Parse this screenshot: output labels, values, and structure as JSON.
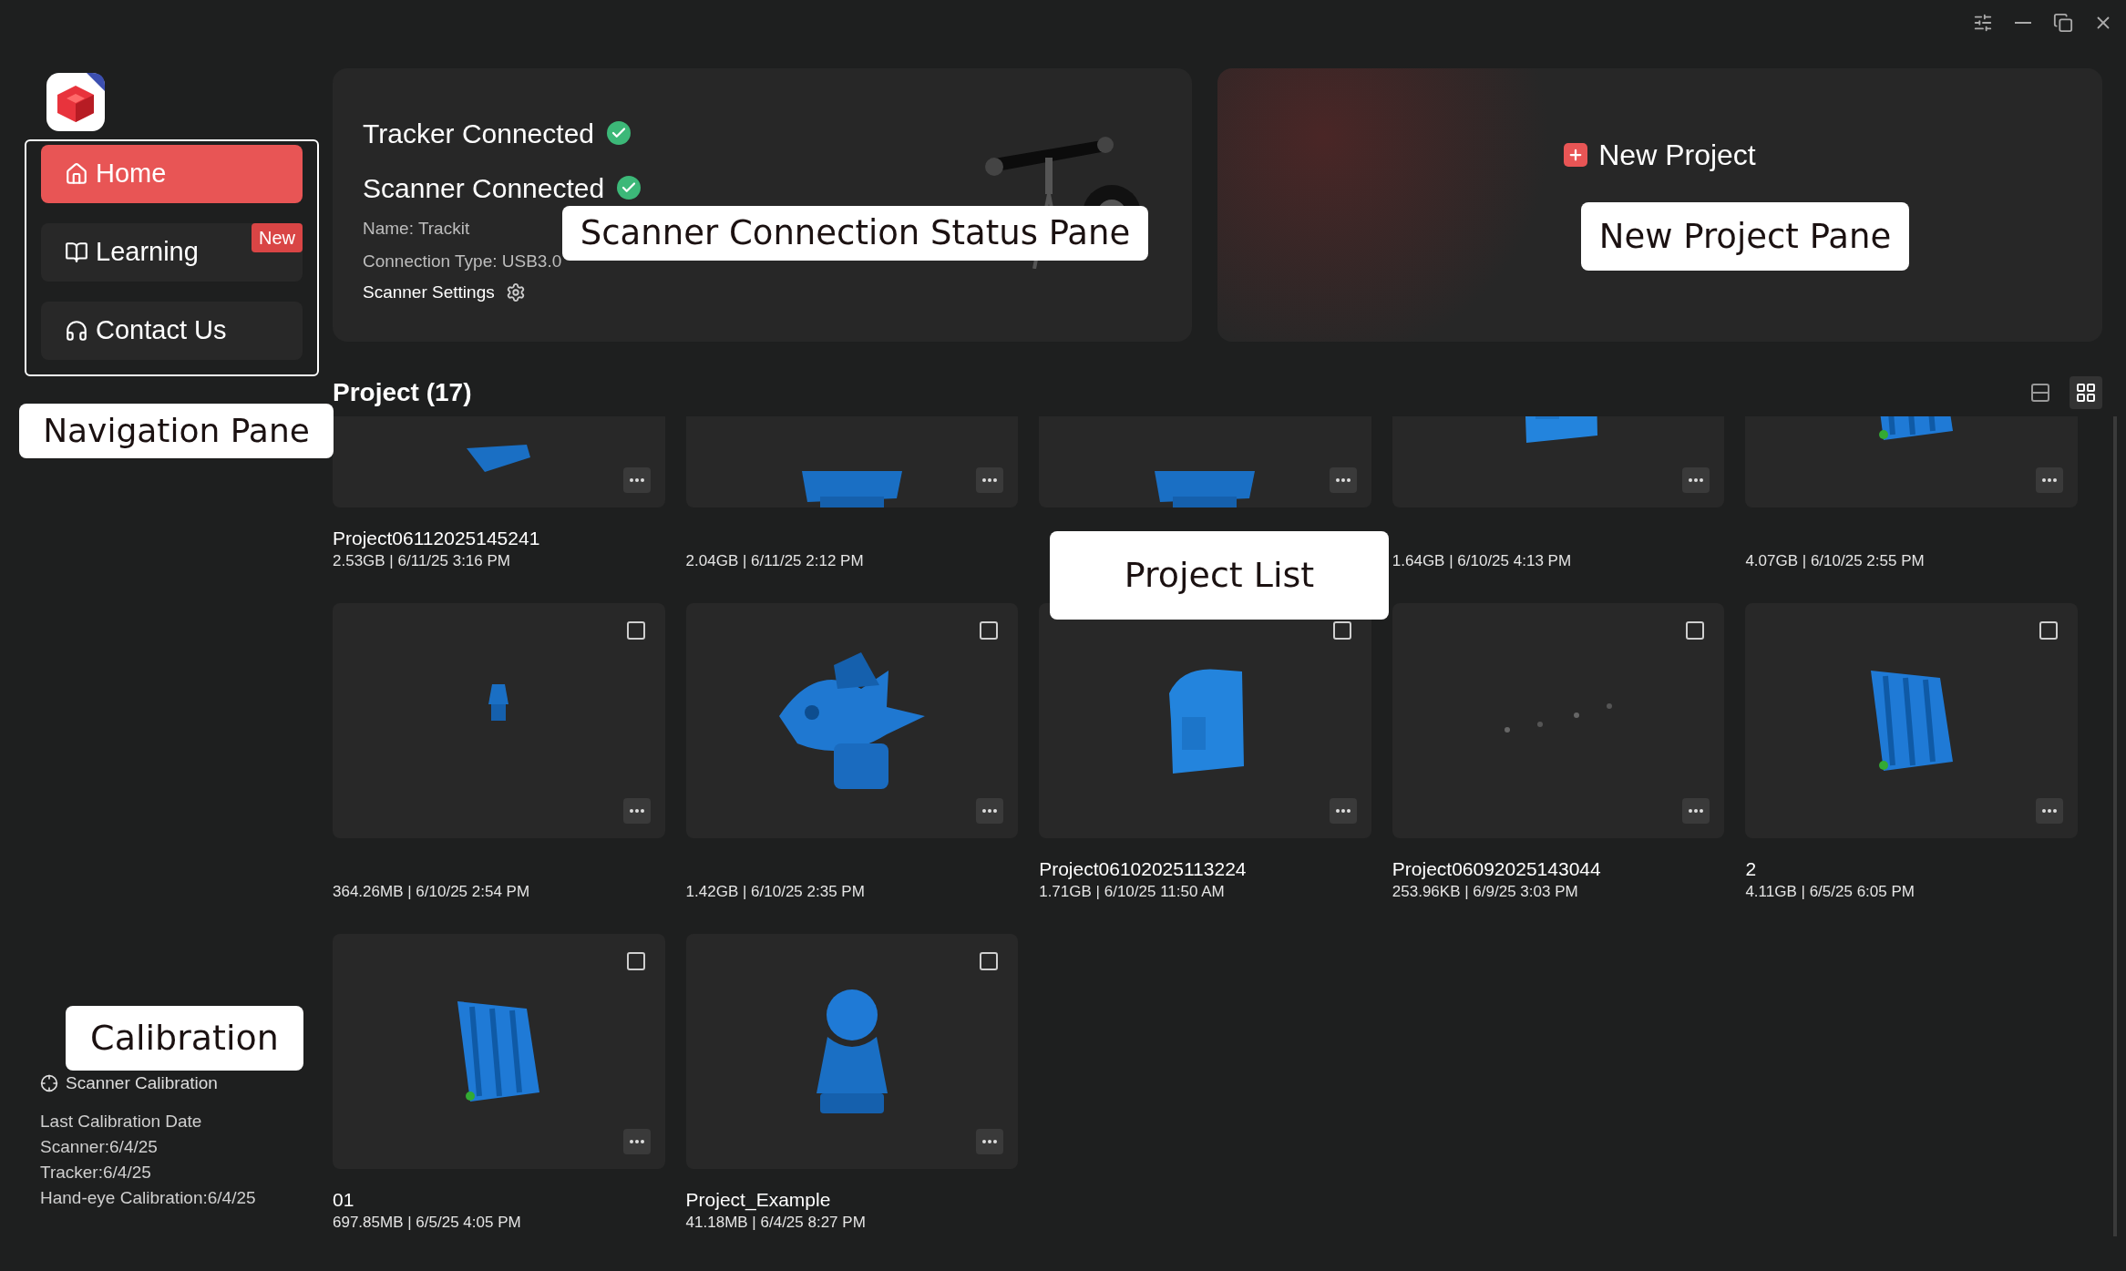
{
  "window_controls": [
    {
      "kind": "settings"
    },
    {
      "kind": "minimize"
    },
    {
      "kind": "restore"
    },
    {
      "kind": "close"
    }
  ],
  "sidebar": {
    "items": [
      {
        "kind": "home",
        "label": "Home",
        "selected": true
      },
      {
        "kind": "learning",
        "label": "Learning",
        "selected": false,
        "badge": "New"
      },
      {
        "kind": "contact",
        "label": "Contact Us",
        "selected": false
      }
    ],
    "calibration": {
      "button": "Scanner Calibration",
      "lines": [
        "Last Calibration Date",
        "Scanner:6/4/25",
        "Tracker:6/4/25",
        "Hand-eye Calibration:6/4/25"
      ]
    }
  },
  "status_pane": {
    "statuses": [
      {
        "label": "Tracker Connected",
        "connected": true
      },
      {
        "label": "Scanner Connected",
        "connected": true
      }
    ],
    "details": [
      "Name: Trackit",
      "Connection Type: USB3.0"
    ],
    "settings": "Scanner Settings"
  },
  "new_project": {
    "label": "New Project"
  },
  "projects": {
    "title": "Project (17)",
    "views": [
      {
        "kind": "list",
        "selected": false
      },
      {
        "kind": "grid",
        "selected": true
      }
    ],
    "cards": [
      {
        "name": "Project06112025145241",
        "meta": "2.53GB | 6/11/25 3:16 PM"
      },
      {
        "meta": "2.04GB | 6/11/25 2:12 PM"
      },
      {
        "kind": "project"
      },
      {
        "meta": "1.64GB | 6/10/25 4:13 PM"
      },
      {
        "meta": "4.07GB | 6/10/25 2:55 PM"
      },
      {
        "meta": "364.26MB | 6/10/25 2:54 PM",
        "checked": false
      },
      {
        "meta": "1.42GB | 6/10/25 2:35 PM",
        "checked": false
      },
      {
        "name": "Project06102025113224",
        "meta": "1.71GB | 6/10/25 11:50 AM",
        "checked": false
      },
      {
        "name": "Project06092025143044",
        "meta": "253.96KB | 6/9/25 3:03 PM",
        "checked": false
      },
      {
        "name": "2",
        "meta": "4.11GB | 6/5/25 6:05 PM",
        "checked": false
      },
      {
        "name": "01",
        "meta": "697.85MB | 6/5/25 4:05 PM",
        "checked": false
      },
      {
        "name": "Project_Example",
        "meta": "41.18MB | 6/4/25 8:27 PM",
        "checked": false
      }
    ]
  },
  "annotations": [
    {
      "kind": "status",
      "text": "Scanner Connection Status Pane"
    },
    {
      "kind": "new",
      "text": "New Project Pane"
    },
    {
      "kind": "nav",
      "text": "Navigation Pane"
    },
    {
      "kind": "list",
      "text": "Project List"
    },
    {
      "kind": "calibration",
      "text": "Calibration"
    }
  ]
}
